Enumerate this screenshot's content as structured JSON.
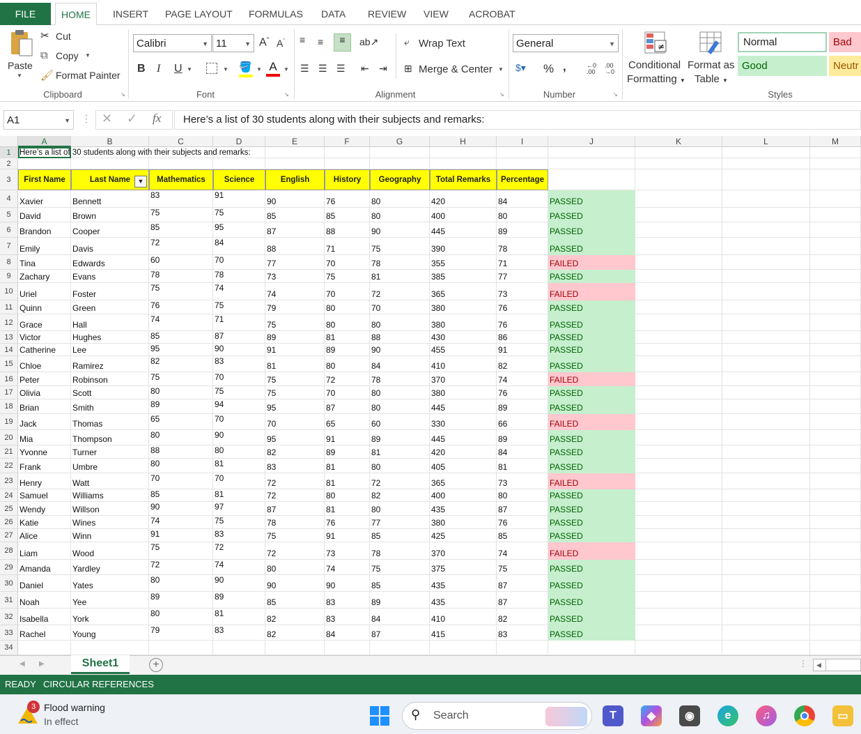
{
  "ribbon": {
    "tabs": [
      "FILE",
      "HOME",
      "INSERT",
      "PAGE LAYOUT",
      "FORMULAS",
      "DATA",
      "REVIEW",
      "VIEW",
      "ACROBAT"
    ],
    "clipboard": {
      "paste": "Paste",
      "cut": "Cut",
      "copy": "Copy",
      "format_painter": "Format Painter",
      "label": "Clipboard"
    },
    "font": {
      "name": "Calibri",
      "size": "11",
      "label": "Font"
    },
    "alignment": {
      "wrap_text": "Wrap Text",
      "merge_center": "Merge & Center",
      "label": "Alignment"
    },
    "number": {
      "format": "General",
      "label": "Number"
    },
    "styles": {
      "conditional": "Conditional",
      "conditional2": "Formatting",
      "format_as": "Format as",
      "format_as2": "Table",
      "normal": "Normal",
      "bad": "Bad",
      "good": "Good",
      "neutral": "Neutr",
      "label": "Styles"
    }
  },
  "formula_bar": {
    "name_box": "A1",
    "content": "Here’s a list of 30 students along with their subjects and remarks:"
  },
  "sheet": {
    "columns": [
      "A",
      "B",
      "C",
      "D",
      "E",
      "F",
      "G",
      "H",
      "I",
      "J",
      "K",
      "L",
      "M"
    ],
    "title_cell": "Here’s a list of 30 students along with their subjects and remarks:",
    "headers": [
      "First Name",
      "Last Name",
      "Mathematics",
      "Science",
      "English",
      "History",
      "Geography",
      "Total Remarks",
      "Percentage"
    ],
    "rows": [
      [
        "Xavier",
        "Bennett",
        "83",
        "91",
        "90",
        "76",
        "80",
        "420",
        "84",
        "PASSED"
      ],
      [
        "David",
        "Brown",
        "75",
        "75",
        "85",
        "85",
        "80",
        "400",
        "80",
        "PASSED"
      ],
      [
        "Brandon",
        "Cooper",
        "85",
        "95",
        "87",
        "88",
        "90",
        "445",
        "89",
        "PASSED"
      ],
      [
        "Emily",
        "Davis",
        "72",
        "84",
        "88",
        "71",
        "75",
        "390",
        "78",
        "PASSED"
      ],
      [
        "Tina",
        "Edwards",
        "60",
        "70",
        "77",
        "70",
        "78",
        "355",
        "71",
        "FAILED"
      ],
      [
        "Zachary",
        "Evans",
        "78",
        "78",
        "73",
        "75",
        "81",
        "385",
        "77",
        "PASSED"
      ],
      [
        "Uriel",
        "Foster",
        "75",
        "74",
        "74",
        "70",
        "72",
        "365",
        "73",
        "FAILED"
      ],
      [
        "Quinn",
        "Green",
        "76",
        "75",
        "79",
        "80",
        "70",
        "380",
        "76",
        "PASSED"
      ],
      [
        "Grace",
        "Hall",
        "74",
        "71",
        "75",
        "80",
        "80",
        "380",
        "76",
        "PASSED"
      ],
      [
        "Victor",
        "Hughes",
        "85",
        "87",
        "89",
        "81",
        "88",
        "430",
        "86",
        "PASSED"
      ],
      [
        "Catherine",
        "Lee",
        "95",
        "90",
        "91",
        "89",
        "90",
        "455",
        "91",
        "PASSED"
      ],
      [
        "Chloe",
        "Ramirez",
        "82",
        "83",
        "81",
        "80",
        "84",
        "410",
        "82",
        "PASSED"
      ],
      [
        "Peter",
        "Robinson",
        "75",
        "70",
        "75",
        "72",
        "78",
        "370",
        "74",
        "FAILED"
      ],
      [
        "Olivia",
        "Scott",
        "80",
        "75",
        "75",
        "70",
        "80",
        "380",
        "76",
        "PASSED"
      ],
      [
        "Brian",
        "Smith",
        "89",
        "94",
        "95",
        "87",
        "80",
        "445",
        "89",
        "PASSED"
      ],
      [
        "Jack",
        "Thomas",
        "65",
        "70",
        "70",
        "65",
        "60",
        "330",
        "66",
        "FAILED"
      ],
      [
        "Mia",
        "Thompson",
        "80",
        "90",
        "95",
        "91",
        "89",
        "445",
        "89",
        "PASSED"
      ],
      [
        "Yvonne",
        "Turner",
        "88",
        "80",
        "82",
        "89",
        "81",
        "420",
        "84",
        "PASSED"
      ],
      [
        "Frank",
        "Umbre",
        "80",
        "81",
        "83",
        "81",
        "80",
        "405",
        "81",
        "PASSED"
      ],
      [
        "Henry",
        "Watt",
        "70",
        "70",
        "72",
        "81",
        "72",
        "365",
        "73",
        "FAILED"
      ],
      [
        "Samuel",
        "Williams",
        "85",
        "81",
        "72",
        "80",
        "82",
        "400",
        "80",
        "PASSED"
      ],
      [
        "Wendy",
        "Willson",
        "90",
        "97",
        "87",
        "81",
        "80",
        "435",
        "87",
        "PASSED"
      ],
      [
        "Katie",
        "Wines",
        "74",
        "75",
        "78",
        "76",
        "77",
        "380",
        "76",
        "PASSED"
      ],
      [
        "Alice",
        "Winn",
        "91",
        "83",
        "75",
        "91",
        "85",
        "425",
        "85",
        "PASSED"
      ],
      [
        "Liam",
        "Wood",
        "75",
        "72",
        "72",
        "73",
        "78",
        "370",
        "74",
        "FAILED"
      ],
      [
        "Amanda",
        "Yardley",
        "72",
        "74",
        "80",
        "74",
        "75",
        "375",
        "75",
        "PASSED"
      ],
      [
        "Daniel",
        "Yates",
        "80",
        "90",
        "90",
        "90",
        "85",
        "435",
        "87",
        "PASSED"
      ],
      [
        "Noah",
        "Yee",
        "89",
        "89",
        "85",
        "83",
        "89",
        "435",
        "87",
        "PASSED"
      ],
      [
        "Isabella",
        "York",
        "80",
        "81",
        "82",
        "83",
        "84",
        "410",
        "82",
        "PASSED"
      ],
      [
        "Rachel",
        "Young",
        "79",
        "83",
        "82",
        "84",
        "87",
        "415",
        "83",
        "PASSED"
      ]
    ],
    "sheet_tab": "Sheet1"
  },
  "status": {
    "ready": "READY",
    "circular": "CIRCULAR REFERENCES"
  },
  "taskbar": {
    "weather_title": "Flood warning",
    "weather_sub": "In effect",
    "weather_badge": "3",
    "search": "Search"
  },
  "colors": {
    "excel_green": "#217346",
    "passed_bg": "#c6efce",
    "passed_text": "#006100",
    "failed_bg": "#ffc7ce",
    "failed_text": "#9c0006",
    "header_yellow": "#ffff00"
  }
}
